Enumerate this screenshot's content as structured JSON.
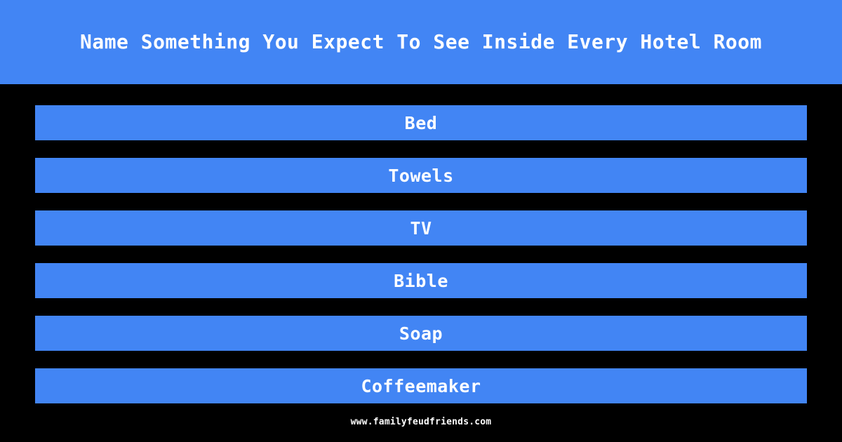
{
  "theme": {
    "background_color": "#000000",
    "accent_color": "#4285f4",
    "text_color": "#ffffff"
  },
  "header": {
    "title": "Name Something You Expect To See Inside Every Hotel Room"
  },
  "answers": {
    "items": [
      {
        "rank": 1,
        "label": "Bed"
      },
      {
        "rank": 2,
        "label": "Towels"
      },
      {
        "rank": 3,
        "label": "TV"
      },
      {
        "rank": 4,
        "label": "Bible"
      },
      {
        "rank": 5,
        "label": "Soap"
      },
      {
        "rank": 6,
        "label": "Coffeemaker"
      }
    ]
  },
  "footer": {
    "url": "www.familyfeudfriends.com"
  }
}
